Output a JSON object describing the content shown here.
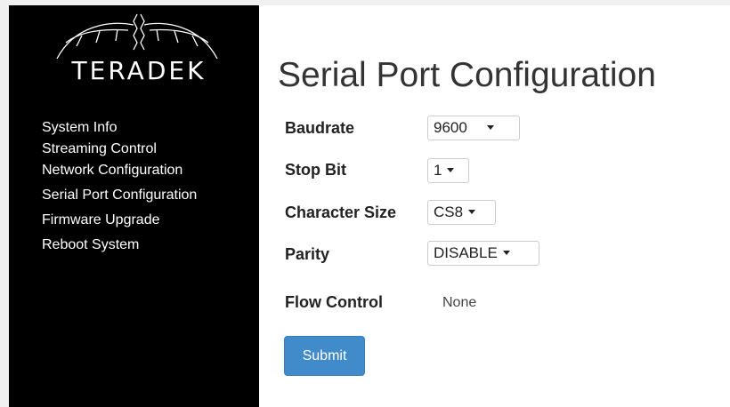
{
  "brand": {
    "name": "TERADEK",
    "logo_icon": "teradek-antenna-logo"
  },
  "sidebar": {
    "items": [
      {
        "label": "System Info"
      },
      {
        "label": "Streaming Control"
      },
      {
        "label": "Network Configuration"
      },
      {
        "label": "Serial Port Configuration"
      },
      {
        "label": "Firmware Upgrade"
      },
      {
        "label": "Reboot System"
      }
    ]
  },
  "main": {
    "title": "Serial Port Configuration",
    "fields": {
      "baudrate": {
        "label": "Baudrate",
        "value": "9600"
      },
      "stop_bit": {
        "label": "Stop Bit",
        "value": "1"
      },
      "character_size": {
        "label": "Character Size",
        "value": "CS8"
      },
      "parity": {
        "label": "Parity",
        "value": "DISABLE"
      },
      "flow_control": {
        "label": "Flow Control",
        "value": "None"
      }
    },
    "submit_label": "Submit"
  },
  "colors": {
    "sidebar_bg": "#000000",
    "primary_button": "#428bca",
    "text": "#333333"
  }
}
